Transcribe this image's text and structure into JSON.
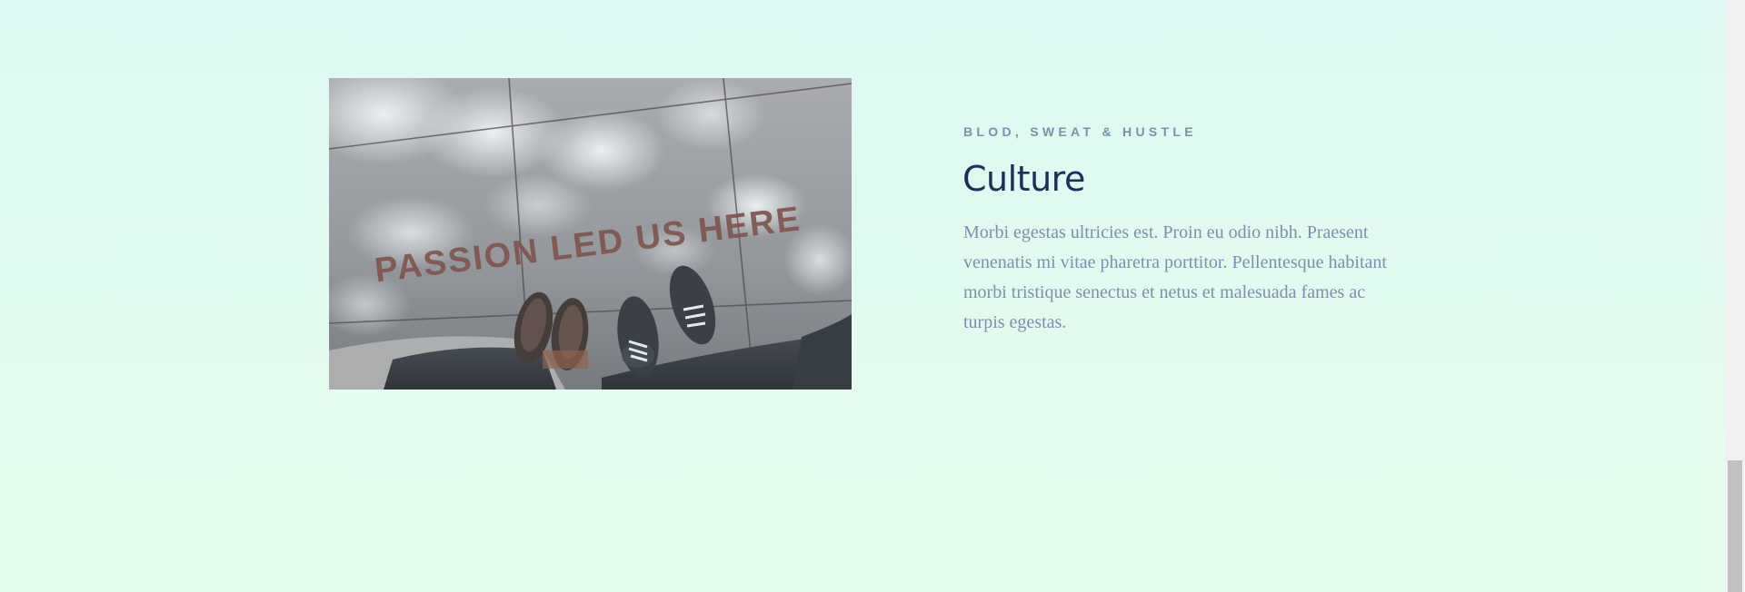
{
  "feature": {
    "eyebrow": "BLOD, SWEAT & HUSTLE",
    "title": "Culture",
    "body": "Morbi egestas ultricies est. Proin eu odio nibh. Praesent venenatis mi vitae pharetra porttitor. Pellentesque habitant morbi tristique senectus et netus et malesuada fames ac turpis egestas.",
    "photo_caption": "PASSION LED US HERE"
  },
  "colors": {
    "background_top": "#def9f3",
    "background_bottom": "#e7fdec",
    "heading": "#1b2f5c",
    "muted_text": "#7d8fad",
    "photo_lettering": "#7a4a44"
  }
}
